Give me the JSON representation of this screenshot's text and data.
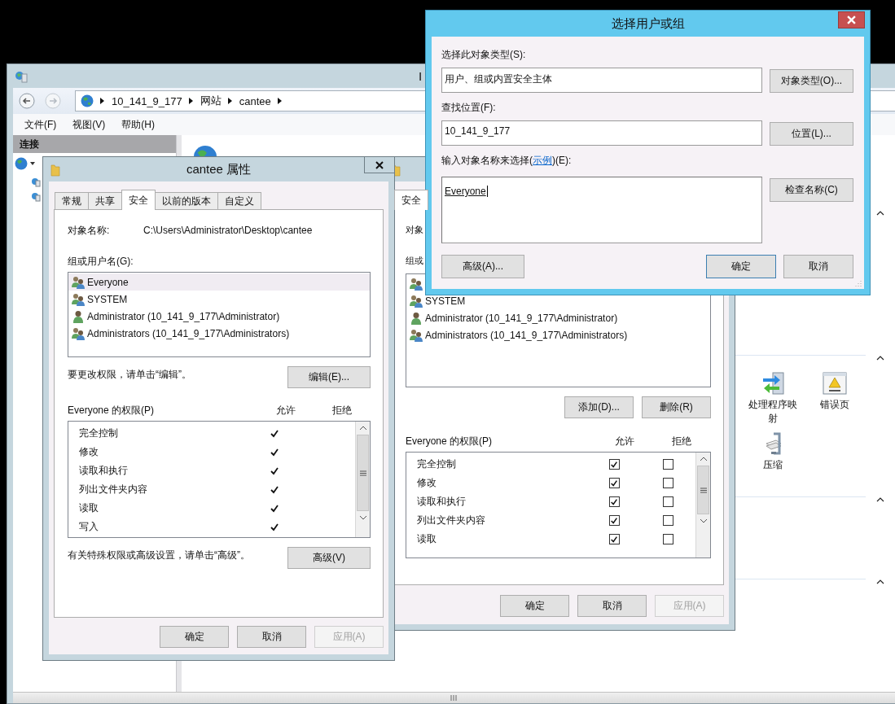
{
  "iis_window": {
    "title": "I",
    "address": [
      "10_141_9_177",
      "网站",
      "cantee"
    ],
    "menu": [
      "文件(F)",
      "视图(V)",
      "帮助(H)"
    ],
    "connections_title": "连接",
    "features": [
      {
        "label": "处理程序映射",
        "kind": "handler"
      },
      {
        "label": "错误页",
        "kind": "error"
      },
      {
        "label": "压缩",
        "kind": "compress"
      }
    ]
  },
  "properties_dialog": {
    "title": "cantee 属性",
    "tabs": [
      {
        "label": "常规",
        "selected": false
      },
      {
        "label": "共享",
        "selected": false
      },
      {
        "label": "安全",
        "selected": true
      },
      {
        "label": "以前的版本",
        "selected": false
      },
      {
        "label": "自定义",
        "selected": false
      }
    ],
    "object_label": "对象名称:",
    "object_path": "C:\\Users\\Administrator\\Desktop\\cantee",
    "users_label": "组或用户名(G):",
    "users": [
      {
        "name": "Everyone",
        "kind": "group",
        "selected": true
      },
      {
        "name": "SYSTEM",
        "kind": "group",
        "selected": false
      },
      {
        "name": "Administrator (10_141_9_177\\Administrator)",
        "kind": "user",
        "selected": false
      },
      {
        "name": "Administrators (10_141_9_177\\Administrators)",
        "kind": "group",
        "selected": false
      }
    ],
    "edit_hint": "要更改权限，请单击“编辑”。",
    "edit_button": "编辑(E)...",
    "permissions_label": "Everyone 的权限(P)",
    "allow_header": "允许",
    "deny_header": "拒绝",
    "permissions": [
      {
        "name": "完全控制",
        "allow": true,
        "deny": false
      },
      {
        "name": "修改",
        "allow": true,
        "deny": false
      },
      {
        "name": "读取和执行",
        "allow": true,
        "deny": false
      },
      {
        "name": "列出文件夹内容",
        "allow": true,
        "deny": false
      },
      {
        "name": "读取",
        "allow": true,
        "deny": false
      },
      {
        "name": "写入",
        "allow": true,
        "deny": false
      }
    ],
    "advanced_hint": "有关特殊权限或高级设置，请单击“高级”。",
    "advanced_button": "高级(V)",
    "buttons": [
      {
        "label": "确定",
        "disabled": false
      },
      {
        "label": "取消",
        "disabled": false
      },
      {
        "label": "应用(A)",
        "disabled": true
      }
    ]
  },
  "permissions_dialog": {
    "tabs": [
      {
        "label": "安全",
        "selected": true
      }
    ],
    "object_label": "对象",
    "users_label": "组或",
    "users": [
      {
        "kind": "group",
        "selected": false
      },
      {
        "name": "SYSTEM",
        "kind": "group",
        "selected": false
      },
      {
        "name": "Administrator (10_141_9_177\\Administrator)",
        "kind": "user",
        "selected": false
      },
      {
        "name": "Administrators (10_141_9_177\\Administrators)",
        "kind": "group",
        "selected": false
      }
    ],
    "add_button": "添加(D)...",
    "remove_button": "删除(R)",
    "permissions_label": "Everyone 的权限(P)",
    "allow_header": "允许",
    "deny_header": "拒绝",
    "permissions": [
      {
        "name": "完全控制",
        "allow": true,
        "deny": false
      },
      {
        "name": "修改",
        "allow": true,
        "deny": false
      },
      {
        "name": "读取和执行",
        "allow": true,
        "deny": false
      },
      {
        "name": "列出文件夹内容",
        "allow": true,
        "deny": false
      },
      {
        "name": "读取",
        "allow": true,
        "deny": false
      }
    ],
    "buttons": [
      {
        "label": "确定",
        "disabled": false
      },
      {
        "label": "取消",
        "disabled": false
      },
      {
        "label": "应用(A)",
        "disabled": true
      }
    ]
  },
  "select_dialog": {
    "title": "选择用户或组",
    "object_types_label": "选择此对象类型(S):",
    "object_types": "用户、组或内置安全主体",
    "object_types_button": "对象类型(O)...",
    "location_label": "查找位置(F):",
    "location": "10_141_9_177",
    "location_button": "位置(L)...",
    "names_label_before": "输入对象名称来选择(",
    "names_link": "示例",
    "names_label_after": ")(E):",
    "names_value": "Everyone",
    "check_button": "检查名称(C)",
    "advanced_button": "高级(A)...",
    "ok_button": "确定",
    "cancel_button": "取消"
  }
}
